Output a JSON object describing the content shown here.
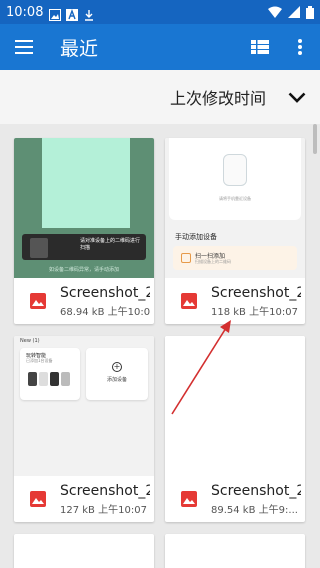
{
  "status_bar": {
    "time": "10:08"
  },
  "app_bar": {
    "title": "最近"
  },
  "sort": {
    "label": "上次修改时间"
  },
  "files": [
    {
      "name": "Screenshot_2021...",
      "size": "68.94 kB",
      "modified": "上午10:07"
    },
    {
      "name": "Screenshot_2021...",
      "size": "118 kB",
      "modified": "上午10:07"
    },
    {
      "name": "Screenshot_2021...",
      "size": "127 kB",
      "modified": "上午10:07"
    },
    {
      "name": "Screenshot_2021...",
      "size": "89.54 kB",
      "modified": "上午9:..."
    }
  ],
  "thumbs": {
    "t1_tip": "请对准设备上的二维码进行扫描",
    "t1_foot": "如设备二维码异常，请手动添加",
    "t2_caption": "请将手机靠近设备",
    "t2_heading": "手动添加设备",
    "t2_scan_title": "扫一扫添加",
    "t2_scan_sub": "扫描设备上的二维码",
    "t3_label": "New (1)",
    "t3_title": "玩转智能",
    "t3_sub": "已添加1台设备",
    "t3_add": "添加设备"
  },
  "colors": {
    "status_bar": "#1565c0",
    "app_bar": "#1976d2",
    "image_icon": "#e53935",
    "arrow": "#d32f2f"
  },
  "icons": {
    "menu": "menu-icon",
    "grid_view": "view-module-icon",
    "more": "more-vert-icon",
    "sort_dropdown": "chevron-down-icon",
    "file_type": "image-icon"
  }
}
